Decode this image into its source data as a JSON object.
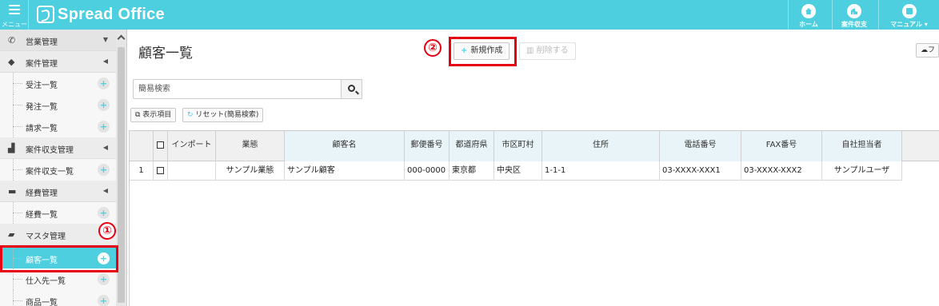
{
  "app": {
    "logo_text": "Spread Office",
    "menu_label": "メニュー",
    "nav": [
      {
        "label": "ホーム",
        "icon": "home-icon"
      },
      {
        "label": "案件収支",
        "icon": "bar-chart-icon"
      },
      {
        "label": "マニュアル ▾",
        "icon": "book-icon"
      }
    ],
    "accent_color": "#4dcfe0",
    "highlight_color": "#e60012"
  },
  "sidebar": {
    "items": [
      {
        "kind": "group",
        "label": "営業管理",
        "icon": "phone-icon",
        "caret": "▼"
      },
      {
        "kind": "group",
        "label": "案件管理",
        "icon": "tag-icon",
        "caret": "◀"
      },
      {
        "kind": "sub",
        "label": "受注一覧"
      },
      {
        "kind": "sub",
        "label": "発注一覧"
      },
      {
        "kind": "sub",
        "label": "請求一覧"
      },
      {
        "kind": "group",
        "label": "案件収支管理",
        "icon": "bar-chart-icon",
        "caret": "◀"
      },
      {
        "kind": "sub",
        "label": "案件収支一覧"
      },
      {
        "kind": "group",
        "label": "経費管理",
        "icon": "credit-card-icon",
        "caret": "◀"
      },
      {
        "kind": "sub",
        "label": "経費一覧"
      },
      {
        "kind": "group",
        "label": "マスタ管理",
        "icon": "folder-open-icon",
        "caret": ""
      },
      {
        "kind": "sub",
        "label": "顧客一覧",
        "active": true
      },
      {
        "kind": "sub",
        "label": "仕入先一覧"
      },
      {
        "kind": "sub",
        "label": "商品一覧"
      }
    ],
    "plus_symbol": "+"
  },
  "annotations": {
    "step1": "①",
    "step2": "②"
  },
  "main": {
    "title": "顧客一覧",
    "new_button": "新規作成",
    "new_button_icon": "+",
    "delete_button": "削除する",
    "cut_off_button": "フ",
    "search_placeholder": "簡易検索",
    "display_items_button": "表示項目",
    "reset_button": "リセット(簡易検索)"
  },
  "grid": {
    "columns": [
      "",
      "",
      "インポート",
      "業態",
      "顧客名",
      "郵便番号",
      "都道府県",
      "市区町村",
      "住所",
      "電話番号",
      "FAX番号",
      "自社担当者"
    ],
    "rows": [
      [
        "1",
        "",
        "",
        "サンプル業態",
        "サンプル顧客",
        "000-0000",
        "東京都",
        "中央区",
        "1-1-1",
        "03-XXXX-XXX1",
        "03-XXXX-XXX2",
        "サンプルユーザ"
      ]
    ]
  }
}
